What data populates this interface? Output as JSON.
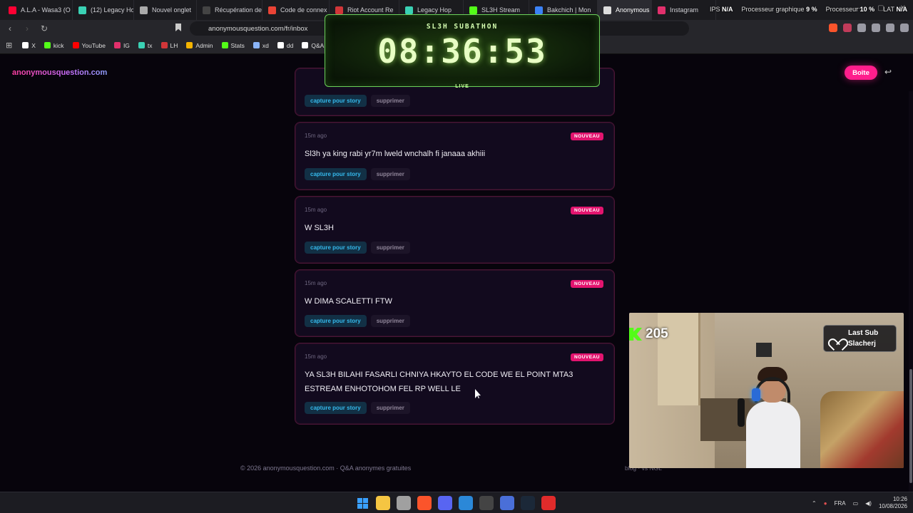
{
  "browser": {
    "tabs": [
      {
        "label": "A.L.A - Wasa3 (O",
        "color": "#ff0033",
        "active": false
      },
      {
        "label": "(12) Legacy Hop",
        "color": "#3ad1b4",
        "active": false
      },
      {
        "label": "Nouvel onglet",
        "color": "#aaaaaa",
        "active": false
      },
      {
        "label": "Récupération de",
        "color": "#444444",
        "active": false
      },
      {
        "label": "Code de connex",
        "color": "#ea4335",
        "active": false
      },
      {
        "label": "Riot Account Re",
        "color": "#d13639",
        "active": false
      },
      {
        "label": "Legacy Hop",
        "color": "#3ad1b4",
        "active": false
      },
      {
        "label": "SL3H Stream",
        "color": "#53fc18",
        "active": false
      },
      {
        "label": "Bakchich | Mon",
        "color": "#3b82f6",
        "active": false
      },
      {
        "label": "Anonymous",
        "color": "#dddddd",
        "active": true
      },
      {
        "label": "Instagram",
        "color": "#e1306c",
        "active": false
      }
    ],
    "url": "anonymousquestion.com/fr/inbox",
    "bookmarks": [
      {
        "label": "X",
        "color": "#ffffff"
      },
      {
        "label": "kick",
        "color": "#53fc18"
      },
      {
        "label": "YouTube",
        "color": "#ff0000"
      },
      {
        "label": "IG",
        "color": "#e1306c"
      },
      {
        "label": "tx",
        "color": "#3ad1b4"
      },
      {
        "label": "LH",
        "color": "#d13639"
      },
      {
        "label": "Admin",
        "color": "#f5b400"
      },
      {
        "label": "Stats",
        "color": "#53fc18"
      },
      {
        "label": "xd",
        "color": "#8ab4f8"
      },
      {
        "label": "dd",
        "color": "#ffffff"
      },
      {
        "label": "Q&A",
        "color": "#ffffff"
      }
    ]
  },
  "hud": {
    "cpu_label": "Processeur",
    "cpu_value": "10 %",
    "gpu_label": "Processeur graphique",
    "gpu_value": "9 %",
    "fps_label": "IPS",
    "fps_value": "N/A",
    "lat_label": "LAT",
    "lat_value": "N/A"
  },
  "site": {
    "logo": "anonymousquestion.com",
    "boite_label": "Boîte",
    "logout_icon": "logout-icon"
  },
  "timer": {
    "title": "SL3H SUBATHON",
    "value": "08:36:53",
    "status": "LIVE"
  },
  "questions": [
    {
      "time": "",
      "badge": "",
      "text": "",
      "story_label": "capture pour story",
      "delete_label": "supprimer"
    },
    {
      "time": "15m ago",
      "badge": "NOUVEAU",
      "text": "Sl3h ya king  rabi yr7m lweld  wnchalh fi janaaa akhiii",
      "story_label": "capture pour story",
      "delete_label": "supprimer"
    },
    {
      "time": "15m ago",
      "badge": "NOUVEAU",
      "text": "W SL3H",
      "story_label": "capture pour story",
      "delete_label": "supprimer"
    },
    {
      "time": "15m ago",
      "badge": "NOUVEAU",
      "text": "W DIMA SCALETTI FTW",
      "story_label": "capture pour story",
      "delete_label": "supprimer"
    },
    {
      "time": "15m ago",
      "badge": "NOUVEAU",
      "text": "YA SL3H BILAHI FASARLI CHNIYA HKAYTO EL CODE WE EL POINT MTA3 ESTREAM ENHOTOHOM FEL RP WELL LE",
      "story_label": "capture pour story",
      "delete_label": "supprimer"
    }
  ],
  "footer": {
    "copyright": "© 2026 anonymousquestion.com · Q&A anonymes gratuites",
    "links": "blog · vs NGL"
  },
  "stream": {
    "viewer_count": "205",
    "last_sub_label": "Last Sub",
    "last_sub_name": "Slacherj"
  },
  "taskbar": {
    "language": "FRA",
    "time": "10:26",
    "date": "10/08/2026",
    "apps": [
      {
        "name": "start",
        "color": "#3aa0ff"
      },
      {
        "name": "file-explorer",
        "color": "#f5c542"
      },
      {
        "name": "snipping-tool",
        "color": "#a0a0a0"
      },
      {
        "name": "brave-browser",
        "color": "#fb542b"
      },
      {
        "name": "discord",
        "color": "#5865f2"
      },
      {
        "name": "photos",
        "color": "#2b88d8"
      },
      {
        "name": "obs",
        "color": "#444444"
      },
      {
        "name": "app",
        "color": "#4a6fd8"
      },
      {
        "name": "steam",
        "color": "#1b2838"
      },
      {
        "name": "streamlabs",
        "color": "#e02b2b"
      }
    ]
  }
}
